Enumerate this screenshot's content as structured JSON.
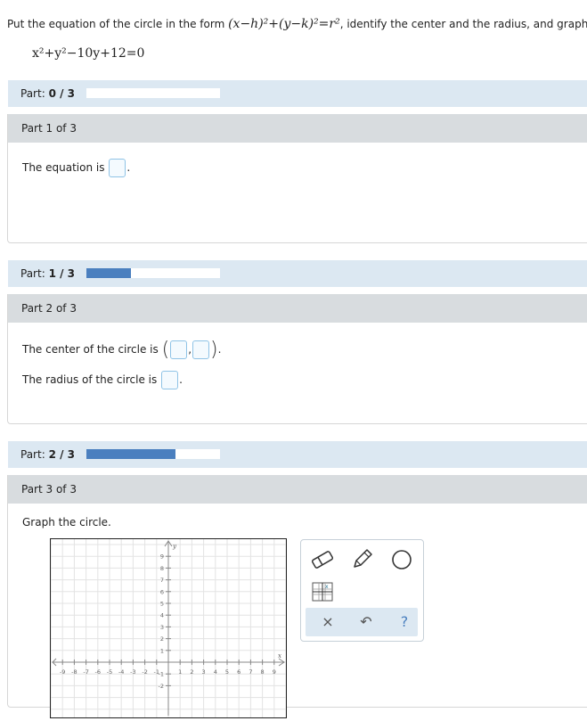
{
  "question": {
    "prompt_before": "Put the equation of the circle in the form ",
    "form_expr": "(x−h)²+(y−k)²=r²",
    "prompt_after": ", identify the center and the radius, and graph.",
    "equation": "x²+y²−10y+12=0"
  },
  "progress_bars": [
    {
      "label": "Part:",
      "value": "0 / 3",
      "fraction": 0.0
    },
    {
      "label": "Part:",
      "value": "1 / 3",
      "fraction": 0.333
    },
    {
      "label": "Part:",
      "value": "2 / 3",
      "fraction": 0.667
    }
  ],
  "parts": [
    {
      "title": "Part 1 of 3",
      "lines": [
        "The equation is",
        "."
      ]
    },
    {
      "title": "Part 2 of 3",
      "center_label": "The center of the circle is",
      "radius_label": "The radius of the circle is",
      "comma": ",",
      "period": "."
    },
    {
      "title": "Part 3 of 3",
      "instruction": "Graph the circle."
    }
  ],
  "graph": {
    "x_axis_label": "x",
    "y_axis_label": "y",
    "x_ticks": [
      "-9",
      "-8",
      "-7",
      "-6",
      "-5",
      "-4",
      "-3",
      "-2",
      "-1",
      "1",
      "2",
      "3",
      "4",
      "5",
      "6",
      "7",
      "8",
      "9"
    ],
    "y_ticks": [
      "9",
      "8",
      "7",
      "6",
      "5",
      "4",
      "3",
      "2",
      "1",
      "-1",
      "-2"
    ]
  },
  "toolbox": {
    "tools": [
      "eraser-icon",
      "pencil-icon",
      "circle-icon",
      "grid-icon"
    ],
    "actions": {
      "clear": "×",
      "undo": "↶",
      "help": "?"
    }
  },
  "colors": {
    "accent": "#4a7fbf",
    "part_bar": "#dce8f2",
    "part_head": "#d8dcdf",
    "answer_border": "#8fc3e6"
  }
}
